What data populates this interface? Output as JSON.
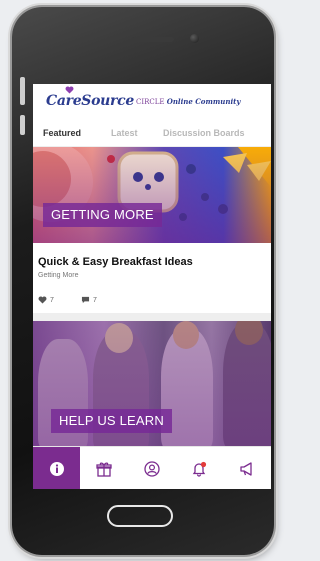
{
  "header": {
    "logo_text": "CareSource",
    "circle_label": "CIRCLE",
    "community_label": "Online Community"
  },
  "tabs": [
    {
      "label": "Featured",
      "active": true
    },
    {
      "label": "Latest",
      "active": false
    },
    {
      "label": "Discussion Boards",
      "active": false
    }
  ],
  "posts": [
    {
      "banner": "GETTING MORE",
      "title": "Quick & Easy Breakfast Ideas",
      "category": "Getting More",
      "likes": "7",
      "comments": "7"
    },
    {
      "banner": "HELP US LEARN"
    }
  ],
  "bottom_nav": [
    {
      "icon": "info-icon",
      "active": true
    },
    {
      "icon": "gift-icon",
      "active": false
    },
    {
      "icon": "profile-icon",
      "active": false
    },
    {
      "icon": "bell-icon",
      "active": false
    },
    {
      "icon": "megaphone-icon",
      "active": false
    }
  ],
  "colors": {
    "brand_purple": "#7b2c8f",
    "brand_navy": "#2b3c8f",
    "notification_red": "#e23b3b"
  }
}
